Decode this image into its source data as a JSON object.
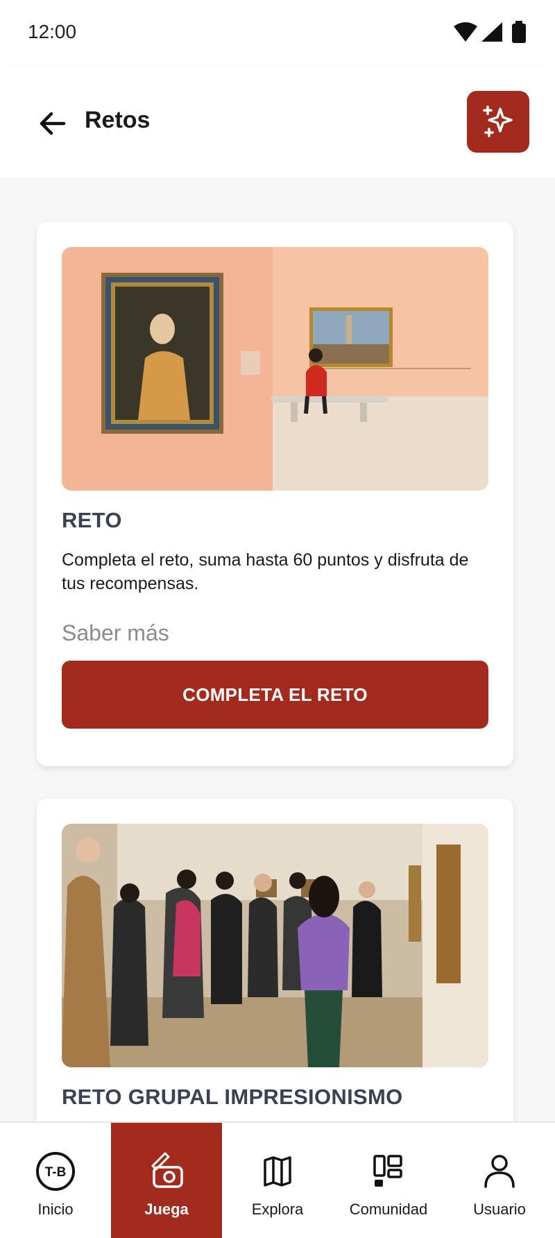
{
  "status_bar": {
    "time": "12:00",
    "icons": [
      "wifi-icon",
      "signal-icon",
      "battery-icon"
    ]
  },
  "app_bar": {
    "title": "Retos",
    "back_icon": "arrow-left-icon",
    "action_icon": "sparkles-icon"
  },
  "challenges": [
    {
      "title": "RETO",
      "description": "Completa el reto, suma hasta 60 puntos y disfruta de tus recompensas.",
      "link_label": "Saber más",
      "cta_label": "COMPLETA EL RETO"
    },
    {
      "title": "RETO GRUPAL IMPRESIONISMO"
    }
  ],
  "bottom_nav": {
    "items": [
      {
        "label": "Inicio",
        "icon": "tb-logo-icon",
        "active": false
      },
      {
        "label": "Juega",
        "icon": "camera-pen-icon",
        "active": true
      },
      {
        "label": "Explora",
        "icon": "map-icon",
        "active": false
      },
      {
        "label": "Comunidad",
        "icon": "widgets-icon",
        "active": false
      },
      {
        "label": "Usuario",
        "icon": "user-icon",
        "active": false
      }
    ]
  },
  "colors": {
    "accent": "#a32b1e",
    "heading": "#3a4152",
    "muted": "#8b8b8b"
  }
}
